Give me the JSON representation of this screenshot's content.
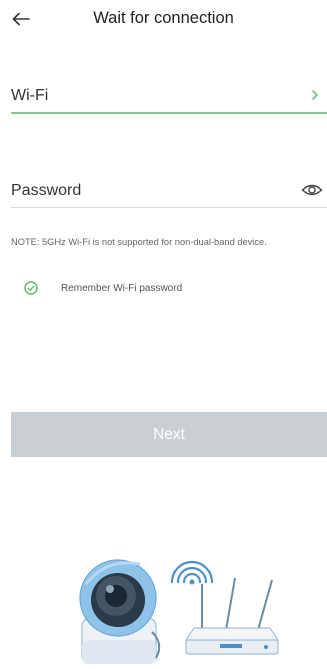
{
  "header": {
    "title": "Wait for connection",
    "back_icon": "arrow-left-icon"
  },
  "form": {
    "wifi": {
      "label": "Wi-Fi",
      "icon": "chevron-right-icon"
    },
    "password": {
      "label": "Password",
      "icon": "eye-icon"
    },
    "note": "NOTE: 5GHz Wi-Fi is not supported for non-dual-band device.",
    "remember": {
      "label": "Remember Wi-Fi password",
      "checked": true,
      "icon": "check-circle-icon"
    }
  },
  "next_button": {
    "label": "Next",
    "enabled": false
  },
  "colors": {
    "accent": "#5dbb6a",
    "disabled_button": "#c9cfd2",
    "camera": "#8fc2e8"
  }
}
